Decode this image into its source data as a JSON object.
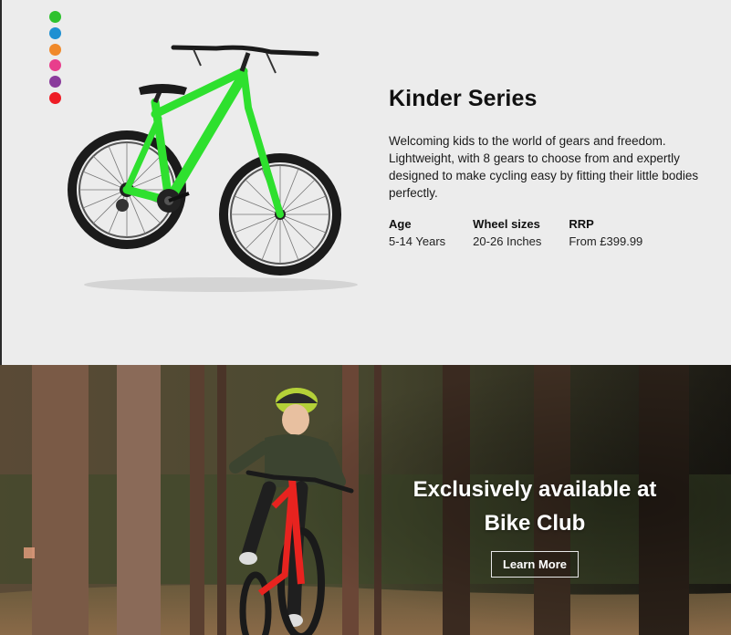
{
  "swatches": [
    {
      "name": "green",
      "color": "#2ec22e"
    },
    {
      "name": "blue",
      "color": "#1e90d2"
    },
    {
      "name": "orange",
      "color": "#f0892a"
    },
    {
      "name": "pink",
      "color": "#e83e8c"
    },
    {
      "name": "purple",
      "color": "#8a3b9c"
    },
    {
      "name": "red",
      "color": "#ee1c25"
    }
  ],
  "product": {
    "title": "Kinder Series",
    "description": "Welcoming kids to the world of gears and freedom. Lightweight, with 8 gears to choose from and expertly designed to make cycling easy by fitting their little bodies perfectly.",
    "specs": [
      {
        "label": "Age",
        "value": "5-14 Years"
      },
      {
        "label": "Wheel sizes",
        "value": "20-26 Inches"
      },
      {
        "label": "RRP",
        "value": "From £399.99"
      }
    ],
    "bike_color": "#2ee02e"
  },
  "hero": {
    "line1": "Exclusively available at",
    "line2": "Bike Club",
    "button_label": "Learn More",
    "bike_color": "#e8231f"
  }
}
